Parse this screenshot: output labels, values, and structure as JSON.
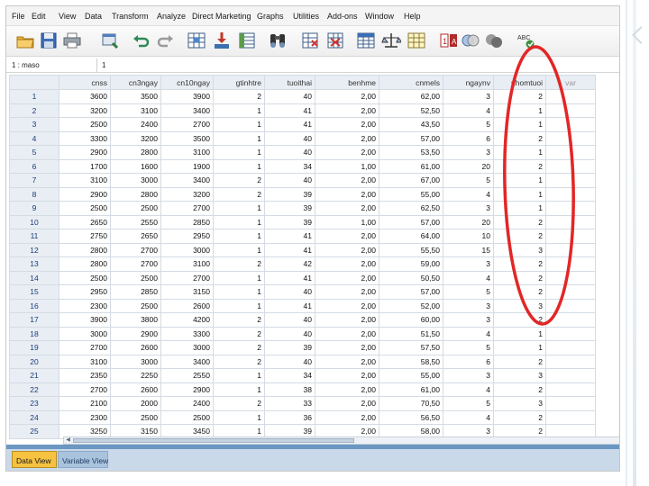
{
  "menu": [
    "File",
    "Edit",
    "View",
    "Data",
    "Transform",
    "Analyze",
    "Direct Marketing",
    "Graphs",
    "Utilities",
    "Add-ons",
    "Window",
    "Help"
  ],
  "cell_editor": {
    "ref": "1 : maso",
    "value": "1"
  },
  "columns": [
    "cnss",
    "cn3ngay",
    "cn10ngay",
    "gtinhtre",
    "tuoithai",
    "benhme",
    "cnmels",
    "ngaynv",
    "nhomtuoi",
    "var"
  ],
  "rows": [
    [
      "1",
      "3600",
      "3500",
      "3900",
      "2",
      "40",
      "2,00",
      "62,00",
      "3",
      "2"
    ],
    [
      "2",
      "3200",
      "3100",
      "3400",
      "1",
      "41",
      "2,00",
      "52,50",
      "4",
      "1"
    ],
    [
      "3",
      "2500",
      "2400",
      "2700",
      "1",
      "41",
      "2,00",
      "43,50",
      "5",
      "1"
    ],
    [
      "4",
      "3300",
      "3200",
      "3500",
      "1",
      "40",
      "2,00",
      "57,00",
      "6",
      "2"
    ],
    [
      "5",
      "2900",
      "2800",
      "3100",
      "1",
      "40",
      "2,00",
      "53,50",
      "3",
      "1"
    ],
    [
      "6",
      "1700",
      "1600",
      "1900",
      "1",
      "34",
      "1,00",
      "61,00",
      "20",
      "2"
    ],
    [
      "7",
      "3100",
      "3000",
      "3400",
      "2",
      "40",
      "2,00",
      "67,00",
      "5",
      "1"
    ],
    [
      "8",
      "2900",
      "2800",
      "3200",
      "2",
      "39",
      "2,00",
      "55,00",
      "4",
      "1"
    ],
    [
      "9",
      "2500",
      "2500",
      "2700",
      "1",
      "39",
      "2,00",
      "62,50",
      "3",
      "1"
    ],
    [
      "10",
      "2650",
      "2550",
      "2850",
      "1",
      "39",
      "1,00",
      "57,00",
      "20",
      "2"
    ],
    [
      "11",
      "2750",
      "2650",
      "2950",
      "1",
      "41",
      "2,00",
      "64,00",
      "10",
      "2"
    ],
    [
      "12",
      "2800",
      "2700",
      "3000",
      "1",
      "41",
      "2,00",
      "55,50",
      "15",
      "3"
    ],
    [
      "13",
      "2800",
      "2700",
      "3100",
      "2",
      "42",
      "2,00",
      "59,00",
      "3",
      "2"
    ],
    [
      "14",
      "2500",
      "2500",
      "2700",
      "1",
      "41",
      "2,00",
      "50,50",
      "4",
      "2"
    ],
    [
      "15",
      "2950",
      "2850",
      "3150",
      "1",
      "40",
      "2,00",
      "57,00",
      "5",
      "2"
    ],
    [
      "16",
      "2300",
      "2500",
      "2600",
      "1",
      "41",
      "2,00",
      "52,00",
      "3",
      "3"
    ],
    [
      "17",
      "3900",
      "3800",
      "4200",
      "2",
      "40",
      "2,00",
      "60,00",
      "3",
      "2"
    ],
    [
      "18",
      "3000",
      "2900",
      "3300",
      "2",
      "40",
      "2,00",
      "51,50",
      "4",
      "1"
    ],
    [
      "19",
      "2700",
      "2600",
      "3000",
      "2",
      "39",
      "2,00",
      "57,50",
      "5",
      "1"
    ],
    [
      "20",
      "3100",
      "3000",
      "3400",
      "2",
      "40",
      "2,00",
      "58,50",
      "6",
      "2"
    ],
    [
      "21",
      "2350",
      "2250",
      "2550",
      "1",
      "34",
      "2,00",
      "55,00",
      "3",
      "3"
    ],
    [
      "22",
      "2700",
      "2600",
      "2900",
      "1",
      "38",
      "2,00",
      "61,00",
      "4",
      "2"
    ],
    [
      "23",
      "2100",
      "2000",
      "2400",
      "2",
      "33",
      "2,00",
      "70,50",
      "5",
      "3"
    ],
    [
      "24",
      "2300",
      "2500",
      "2500",
      "1",
      "36",
      "2,00",
      "56,50",
      "4",
      "2"
    ],
    [
      "25",
      "3250",
      "3150",
      "3450",
      "1",
      "39",
      "2,00",
      "58,00",
      "3",
      "2"
    ]
  ],
  "tabs": {
    "data_view": "Data View",
    "variable_view": "Variable View"
  },
  "colors": {
    "annotation": "#e32626",
    "active_tab": "#f5c242",
    "grid_header": "#e9eef4"
  },
  "toolbar_icons": [
    "open-folder-icon",
    "save-icon",
    "print-icon",
    "dialog-recall-icon",
    "undo-icon",
    "redo-icon",
    "goto-case-icon",
    "goto-variable-icon",
    "variables-icon",
    "find-icon",
    "insert-cases-icon",
    "insert-variable-icon",
    "split-file-icon",
    "weight-cases-icon",
    "select-cases-icon",
    "value-labels-icon",
    "use-sets-icon",
    "show-all-variables-icon",
    "spell-check-icon"
  ]
}
